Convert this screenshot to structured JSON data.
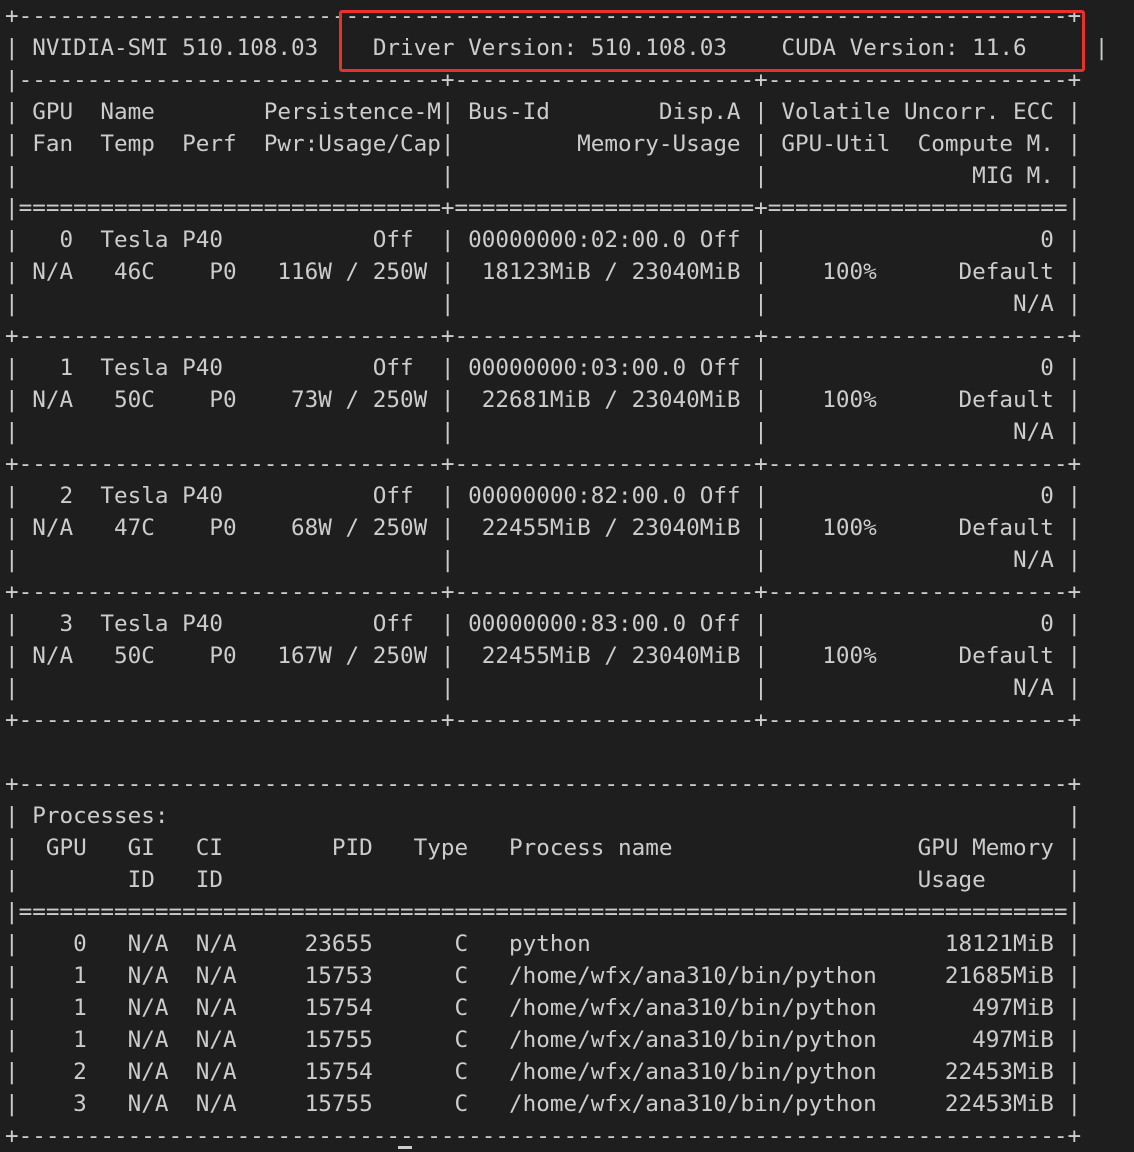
{
  "highlight_color": "#e8312a",
  "text_color": "#cccccc",
  "background_color": "#1e1e1e",
  "header": {
    "smi_version": "NVIDIA-SMI 510.108.03",
    "driver_version": "Driver Version: 510.108.03",
    "cuda_version": "CUDA Version: 11.6"
  },
  "gpu_table": {
    "header_lines": [
      "| GPU  Name        Persistence-M| Bus-Id        Disp.A | Volatile Uncorr. ECC |",
      "| Fan  Temp  Perf  Pwr:Usage/Cap|         Memory-Usage | GPU-Util  Compute M. |",
      "|                               |                      |               MIG M. |"
    ],
    "gpus": [
      {
        "lines": [
          "|   0  Tesla P40           Off  | 00000000:02:00.0 Off |                    0 |",
          "| N/A   46C    P0   116W / 250W |  18123MiB / 23040MiB |    100%      Default |",
          "|                               |                      |                  N/A |"
        ]
      },
      {
        "lines": [
          "|   1  Tesla P40           Off  | 00000000:03:00.0 Off |                    0 |",
          "| N/A   50C    P0    73W / 250W |  22681MiB / 23040MiB |    100%      Default |",
          "|                               |                      |                  N/A |"
        ]
      },
      {
        "lines": [
          "|   2  Tesla P40           Off  | 00000000:82:00.0 Off |                    0 |",
          "| N/A   47C    P0    68W / 250W |  22455MiB / 23040MiB |    100%      Default |",
          "|                               |                      |                  N/A |"
        ]
      },
      {
        "lines": [
          "|   3  Tesla P40           Off  | 00000000:83:00.0 Off |                    0 |",
          "| N/A   50C    P0   167W / 250W |  22455MiB / 23040MiB |    100%      Default |",
          "|                               |                      |                  N/A |"
        ]
      }
    ]
  },
  "processes_table": {
    "header_lines": [
      "| Processes:                                                                  |",
      "|  GPU   GI   CI        PID   Type   Process name                  GPU Memory |",
      "|        ID   ID                                                   Usage      |"
    ],
    "rows": [
      "|    0   N/A  N/A     23655      C   python                          18121MiB |",
      "|    1   N/A  N/A     15753      C   /home/wfx/ana310/bin/python     21685MiB |",
      "|    1   N/A  N/A     15754      C   /home/wfx/ana310/bin/python       497MiB |",
      "|    1   N/A  N/A     15755      C   /home/wfx/ana310/bin/python       497MiB |",
      "|    2   N/A  N/A     15754      C   /home/wfx/ana310/bin/python     22453MiB |",
      "|    3   N/A  N/A     15755      C   /home/wfx/ana310/bin/python     22453MiB |"
    ]
  }
}
